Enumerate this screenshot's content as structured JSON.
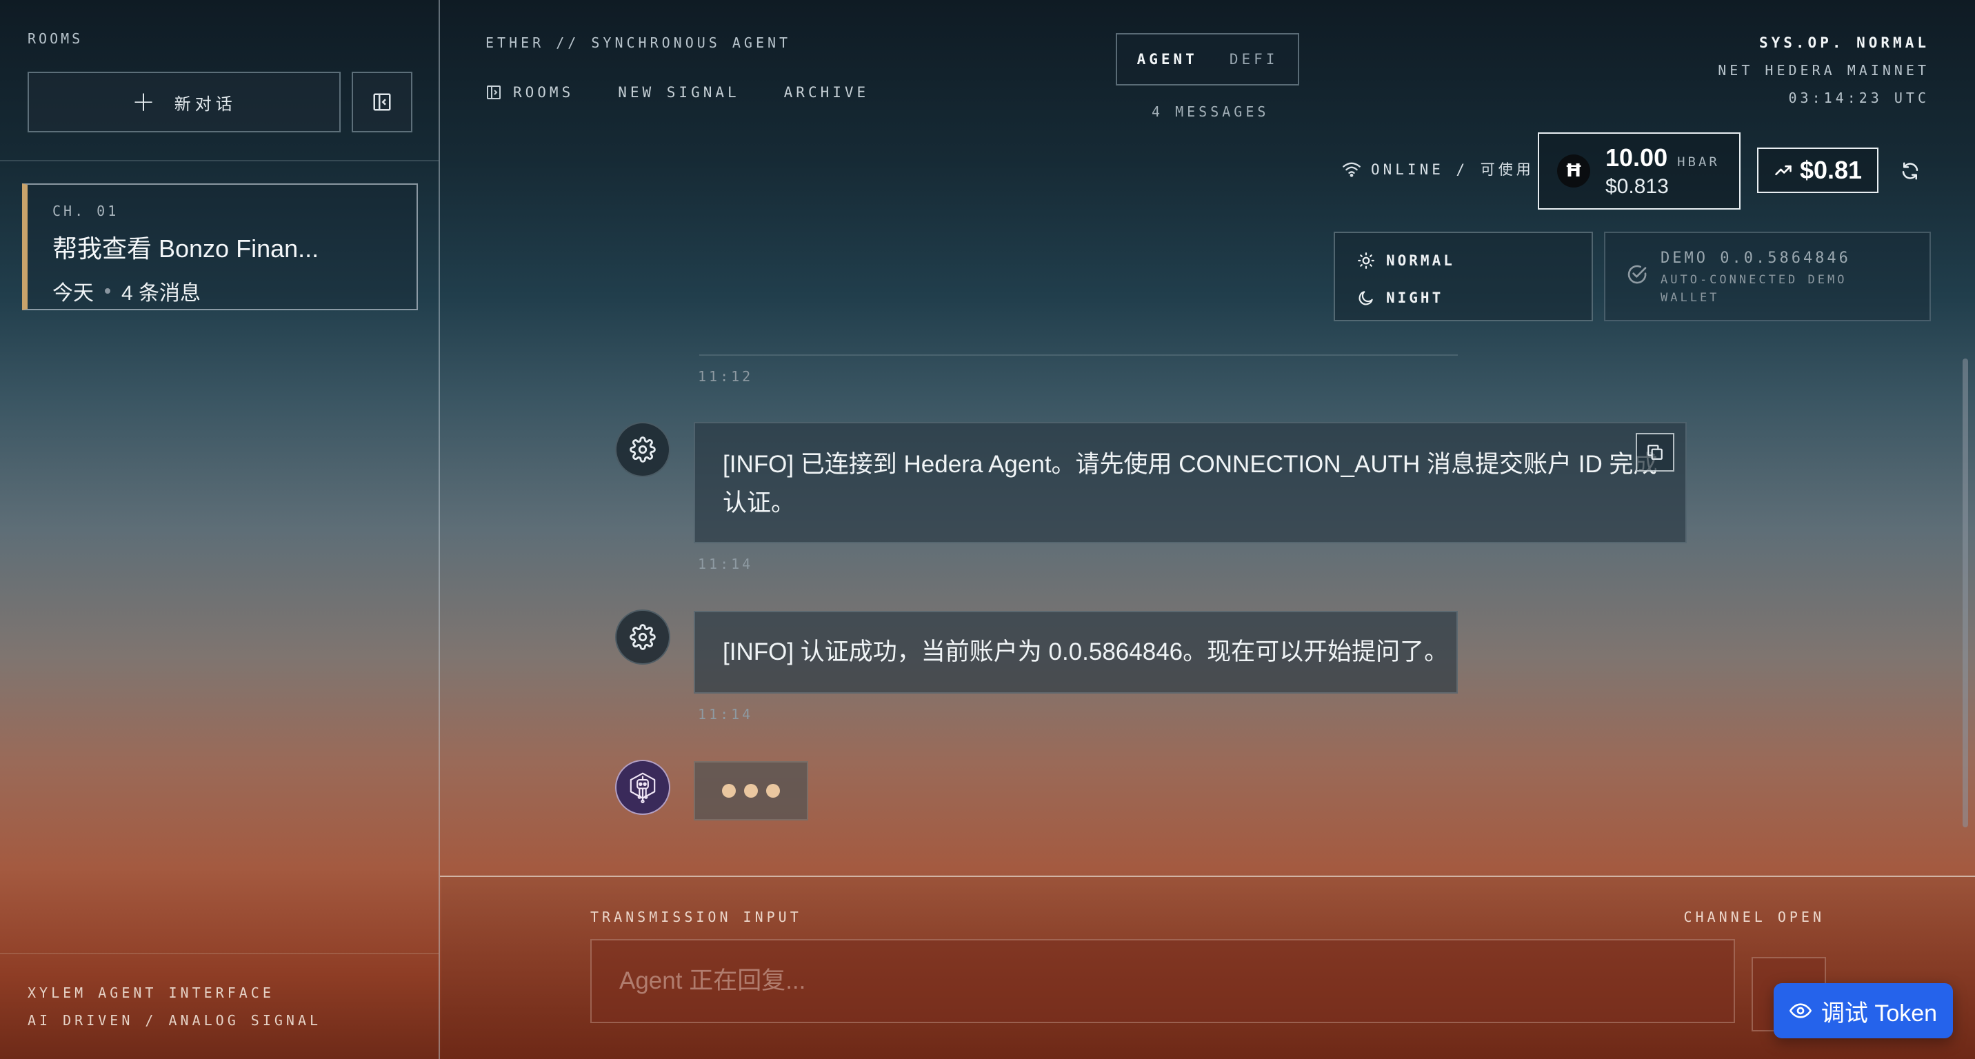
{
  "sidebar": {
    "title": "ROOMS",
    "new_chat_label": "新对话",
    "rooms": [
      {
        "channel": "CH. 01",
        "title": "帮我查看 Bonzo Finan...",
        "date": "今天",
        "count": "4 条消息"
      }
    ],
    "footer_line1": "XYLEM AGENT INTERFACE",
    "footer_line2": "AI DRIVEN / ANALOG SIGNAL"
  },
  "header": {
    "brand": "ETHER // SYNCHRONOUS AGENT",
    "nav": [
      "ROOMS",
      "NEW SIGNAL",
      "ARCHIVE"
    ],
    "tabs": [
      {
        "label": "AGENT",
        "active": true
      },
      {
        "label": "DEFI",
        "active": false
      }
    ],
    "message_count": "4 MESSAGES",
    "sys_status": "SYS.OP. NORMAL",
    "network": "NET HEDERA MAINNET",
    "clock": "03:14:23 UTC",
    "online": "ONLINE / 可使用",
    "balance": {
      "amount": "10.00",
      "unit": "HBAR",
      "usd": "$0.813",
      "logo": "Ħ"
    },
    "price": "$0.81",
    "theme_options": [
      "NORMAL",
      "NIGHT"
    ],
    "wallet": {
      "id": "DEMO 0.0.5864846",
      "sub_line1": "AUTO-CONNECTED DEMO",
      "sub_line2": "WALLET"
    }
  },
  "messages": [
    {
      "time": "11:12",
      "sender": "system",
      "text_line1": "[INFO] 已连接到 Hedera Agent。请先使用 CONNECTION_AUTH 消息提交账户 ID 完成",
      "text_line2": "认证。"
    },
    {
      "time": "11:14",
      "sender": "system",
      "text": "[INFO] 认证成功，当前账户为 0.0.5864846。现在可以开始提问了。"
    },
    {
      "time": "11:14",
      "sender": "agent",
      "typing": true
    }
  ],
  "input": {
    "label": "TRANSMISSION INPUT",
    "status": "CHANNEL OPEN",
    "placeholder": "Agent 正在回复..."
  },
  "debug_button_label": "调试 Token",
  "colors": {
    "accent_gold": "#c9a36b",
    "debug_blue": "#2563eb",
    "typing_dot": "#eac7a0"
  }
}
